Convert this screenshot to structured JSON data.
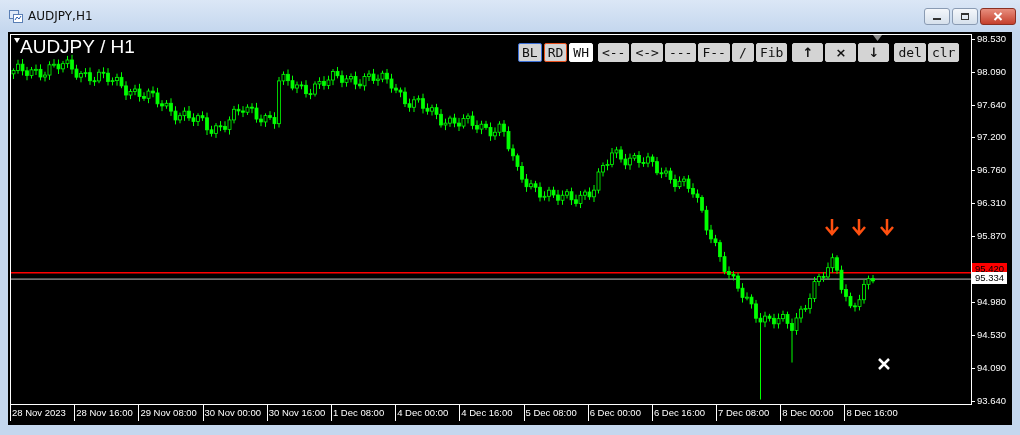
{
  "window": {
    "title": "AUDJPY,H1"
  },
  "chart": {
    "symbol_label": "AUDJPY / H1",
    "toolbar": [
      {
        "label": "BL",
        "kind": "outline",
        "color": "#3b6fd6"
      },
      {
        "label": "RD",
        "kind": "outline",
        "color": "#e8501e"
      },
      {
        "label": "WH",
        "kind": "fill",
        "color": "#ffffff"
      },
      {
        "label": "<--",
        "kind": "plain"
      },
      {
        "label": "<->",
        "kind": "plain"
      },
      {
        "label": "---",
        "kind": "plain"
      },
      {
        "label": "F--",
        "kind": "plain"
      },
      {
        "label": "/",
        "kind": "plain"
      },
      {
        "label": "Fib",
        "kind": "plain"
      },
      {
        "label": "↑",
        "kind": "symbol"
      },
      {
        "label": "×",
        "kind": "symbol"
      },
      {
        "label": "↓",
        "kind": "symbol"
      },
      {
        "label": "del",
        "kind": "plain"
      },
      {
        "label": "clr",
        "kind": "plain"
      }
    ],
    "price_axis": [
      "98.530",
      "98.090",
      "97.640",
      "97.200",
      "96.760",
      "96.310",
      "95.870",
      "94.980",
      "94.530",
      "94.090",
      "93.640"
    ],
    "price_markers": [
      {
        "label": "95.420",
        "kind": "bid"
      },
      {
        "label": "95.334",
        "kind": "current"
      }
    ],
    "time_axis": [
      "28 Nov 2023",
      "28 Nov 16:00",
      "29 Nov 08:00",
      "30 Nov 00:00",
      "30 Nov 16:00",
      "1 Dec 08:00",
      "4 Dec 00:00",
      "4 Dec 16:00",
      "5 Dec 08:00",
      "6 Dec 00:00",
      "6 Dec 16:00",
      "7 Dec 08:00",
      "8 Dec 00:00",
      "8 Dec 16:00"
    ]
  }
}
